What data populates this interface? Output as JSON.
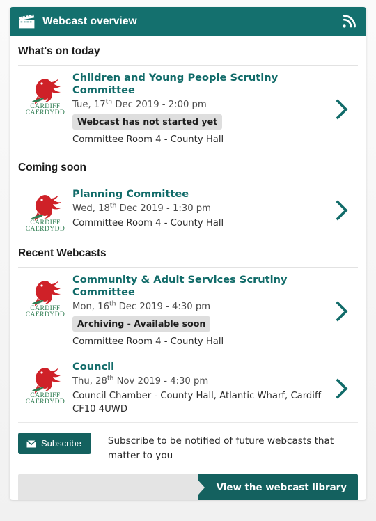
{
  "header": {
    "title": "Webcast overview",
    "icon": "clapperboard-icon",
    "feed_icon": "rss-feed-icon",
    "background_color": "#14706e"
  },
  "sections": [
    {
      "title": "What's on today",
      "events": [
        {
          "logo": "cardiff-council-crest",
          "title": "Children and Young People Scrutiny Committee",
          "date_prefix": "Tue, 17",
          "date_ordinal": "th",
          "date_suffix": " Dec 2019 - 2:00 pm",
          "status": "Webcast has not started yet",
          "location": "Committee Room 4 - County Hall",
          "chevron": "chevron-right-icon"
        }
      ]
    },
    {
      "title": "Coming soon",
      "events": [
        {
          "logo": "cardiff-council-crest",
          "title": "Planning Committee",
          "date_prefix": "Wed, 18",
          "date_ordinal": "th",
          "date_suffix": " Dec 2019 - 1:30 pm",
          "status": "",
          "location": "Committee Room 4 - County Hall",
          "chevron": "chevron-right-icon"
        }
      ]
    },
    {
      "title": "Recent Webcasts",
      "events": [
        {
          "logo": "cardiff-council-crest",
          "title": "Community & Adult Services Scrutiny Committee",
          "date_prefix": "Mon, 16",
          "date_ordinal": "th",
          "date_suffix": " Dec 2019 - 4:30 pm",
          "status": "Archiving - Available soon",
          "location": "Committee Room 4 - County Hall",
          "chevron": "chevron-right-icon"
        },
        {
          "logo": "cardiff-council-crest",
          "title": "Council",
          "date_prefix": "Thu, 28",
          "date_ordinal": "th",
          "date_suffix": " Nov 2019 - 4:30 pm",
          "status": "",
          "location": "Council Chamber - County Hall, Atlantic Wharf, Cardiff CF10 4UWD",
          "chevron": "chevron-right-icon"
        }
      ]
    }
  ],
  "subscribe": {
    "button_label": "Subscribe",
    "button_icon": "envelope-icon",
    "description": "Subscribe to be notified of future webcasts that matter to you",
    "button_color": "#14615f"
  },
  "footer": {
    "library_button_label": "View the webcast library",
    "bar_color": "#e4e4e4",
    "button_color": "#14615f"
  },
  "crest": {
    "line1": "CARDIFF",
    "line2": "CAERDYDD",
    "dragon_color": "#cf2128",
    "text_color": "#2f7d52"
  }
}
